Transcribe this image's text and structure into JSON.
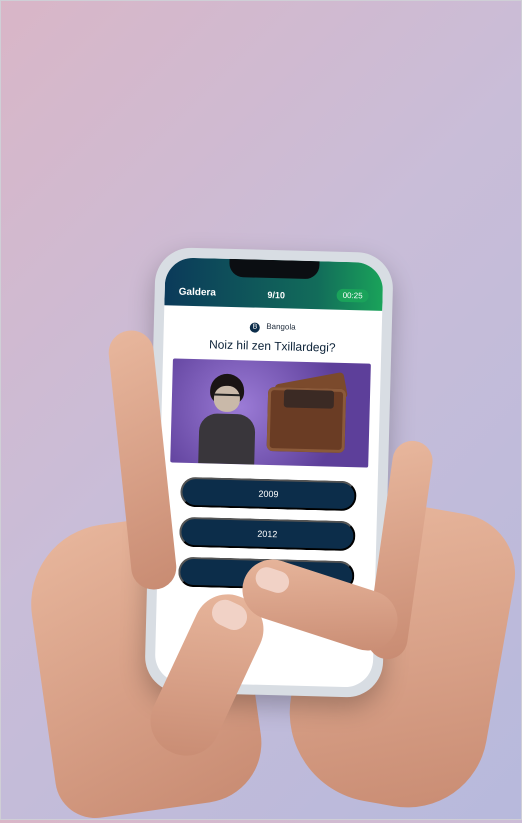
{
  "app_title": "Galdera",
  "status_center": "9/10",
  "timer": "00:25",
  "brand": {
    "logo_letter": "B",
    "name": "Bangola"
  },
  "question": "Noiz hil zen Txillardegi?",
  "answers": [
    "2009",
    "2012",
    ""
  ],
  "colors": {
    "header_gradient_start": "#0b3a5a",
    "header_gradient_end": "#1aa35a",
    "answer_bg": "#0c2d4a"
  }
}
